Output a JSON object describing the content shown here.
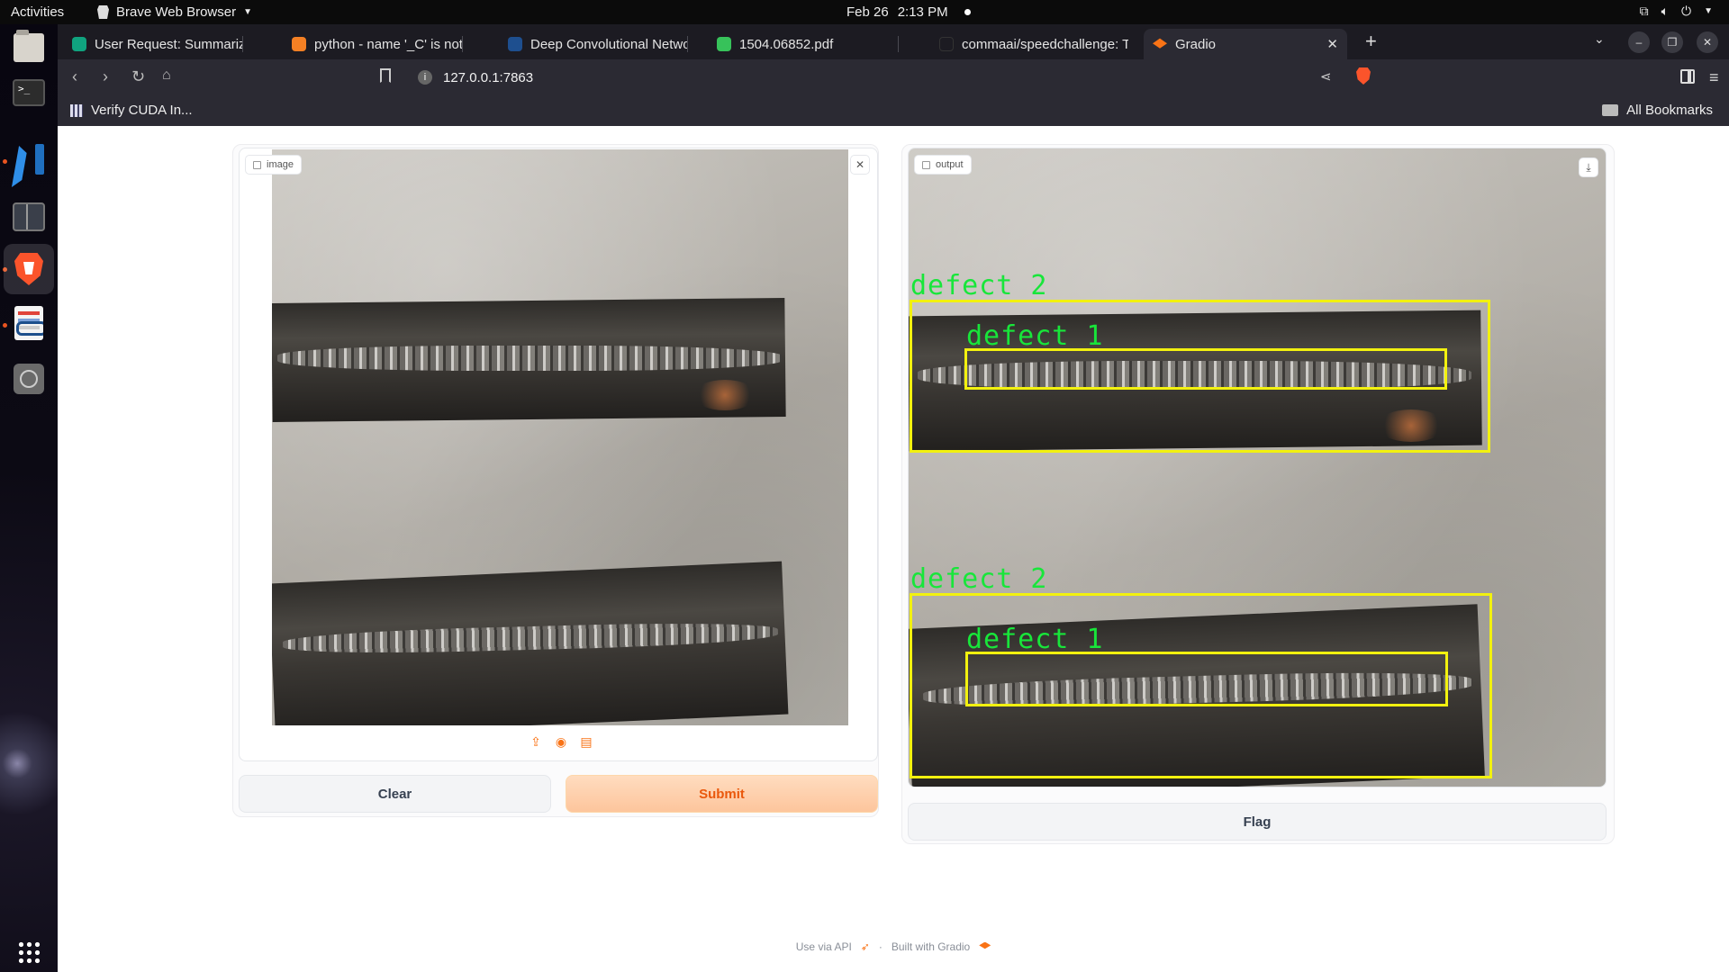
{
  "topbar": {
    "activities": "Activities",
    "app_name": "Brave Web Browser",
    "date": "Feb 26",
    "time": "2:13 PM"
  },
  "browser": {
    "tabs": [
      {
        "title": "User Request: Summarize Co",
        "favicon_color": "#10a37f"
      },
      {
        "title": "python - name '_C' is not def",
        "favicon_color": "#f48024"
      },
      {
        "title": "Deep Convolutional Networ",
        "favicon_color": "#1e4f8f"
      },
      {
        "title": "1504.06852.pdf",
        "favicon_color": "#37c25a"
      },
      {
        "title": "commaai/speedchallenge: T",
        "favicon_color": "#1c1b22"
      },
      {
        "title": "Gradio",
        "favicon_color": "#f97316"
      }
    ],
    "url": "127.0.0.1:7863",
    "bookmarks": {
      "item": "Verify CUDA In...",
      "all": "All Bookmarks"
    }
  },
  "app": {
    "input_label": "image",
    "output_label": "output",
    "clear_label": "Clear",
    "submit_label": "Submit",
    "flag_label": "Flag",
    "detections": [
      {
        "label": "defect 2"
      },
      {
        "label": "defect 1"
      },
      {
        "label": "defect 2"
      },
      {
        "label": "defect 1"
      }
    ],
    "footer": {
      "api": "Use via API",
      "built": "Built with Gradio"
    }
  },
  "colors": {
    "accent": "#f97316",
    "box": "#f2f10f",
    "label_text": "#18e63a"
  }
}
